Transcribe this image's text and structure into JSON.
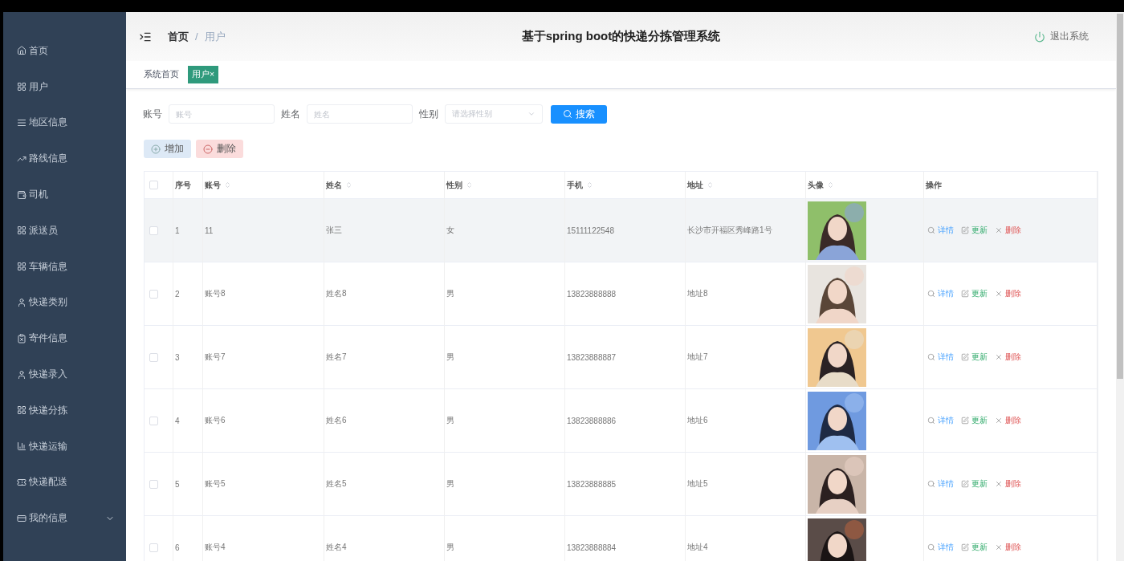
{
  "sidebar": {
    "items": [
      {
        "label": "首页",
        "submenu": false
      },
      {
        "label": "用户",
        "submenu": false
      },
      {
        "label": "地区信息",
        "submenu": false
      },
      {
        "label": "路线信息",
        "submenu": false
      },
      {
        "label": "司机",
        "submenu": false
      },
      {
        "label": "派送员",
        "submenu": false
      },
      {
        "label": "车辆信息",
        "submenu": false
      },
      {
        "label": "快递类别",
        "submenu": false
      },
      {
        "label": "寄件信息",
        "submenu": false
      },
      {
        "label": "快递录入",
        "submenu": false
      },
      {
        "label": "快递分拣",
        "submenu": false
      },
      {
        "label": "快递运输",
        "submenu": false
      },
      {
        "label": "快递配送",
        "submenu": false
      },
      {
        "label": "我的信息",
        "submenu": true
      }
    ]
  },
  "header": {
    "breadcrumb": [
      "首页",
      "用户"
    ],
    "separator": "/",
    "title": "基于spring boot的快递分拣管理系统",
    "logout": "退出系统"
  },
  "tabs": [
    {
      "label": "系统首页",
      "selected": false
    },
    {
      "label": "用户",
      "selected": true,
      "close": "×"
    }
  ],
  "search": {
    "fields": [
      {
        "label": "账号",
        "placeholder": "账号",
        "kind": "input"
      },
      {
        "label": "姓名",
        "placeholder": "姓名",
        "kind": "input"
      },
      {
        "label": "性别",
        "placeholder": "请选择性别",
        "kind": "select"
      }
    ],
    "button": "搜索"
  },
  "actions": {
    "add": "增加",
    "delete": "删除"
  },
  "table": {
    "select_all_checked": false,
    "columns": [
      {
        "label": "序号",
        "sortable": false
      },
      {
        "label": "账号",
        "sortable": true
      },
      {
        "label": "姓名",
        "sortable": true
      },
      {
        "label": "性别",
        "sortable": true
      },
      {
        "label": "手机",
        "sortable": true
      },
      {
        "label": "地址",
        "sortable": true
      },
      {
        "label": "头像",
        "sortable": true
      },
      {
        "label": "操作",
        "sortable": false
      }
    ],
    "rows": [
      {
        "checked": false,
        "hovered": true,
        "cells": [
          "1",
          "11",
          "张三",
          "女",
          "15111122548",
          "长沙市开福区秀峰路1号"
        ],
        "actions": [
          "详情",
          "更新",
          "删除"
        ]
      },
      {
        "checked": false,
        "hovered": false,
        "cells": [
          "2",
          "账号8",
          "姓名8",
          "男",
          "13823888888",
          "地址8"
        ],
        "actions": [
          "详情",
          "更新",
          "删除"
        ]
      },
      {
        "checked": false,
        "hovered": false,
        "cells": [
          "3",
          "账号7",
          "姓名7",
          "男",
          "13823888887",
          "地址7"
        ],
        "actions": [
          "详情",
          "更新",
          "删除"
        ]
      },
      {
        "checked": false,
        "hovered": false,
        "cells": [
          "4",
          "账号6",
          "姓名6",
          "男",
          "13823888886",
          "地址6"
        ],
        "actions": [
          "详情",
          "更新",
          "删除"
        ]
      },
      {
        "checked": false,
        "hovered": false,
        "cells": [
          "5",
          "账号5",
          "姓名5",
          "男",
          "13823888885",
          "地址5"
        ],
        "actions": [
          "详情",
          "更新",
          "删除"
        ]
      },
      {
        "checked": false,
        "hovered": false,
        "cells": [
          "6",
          "账号4",
          "姓名4",
          "男",
          "13823888884",
          "地址4"
        ],
        "actions": [
          "详情",
          "更新",
          "删除"
        ]
      }
    ]
  }
}
